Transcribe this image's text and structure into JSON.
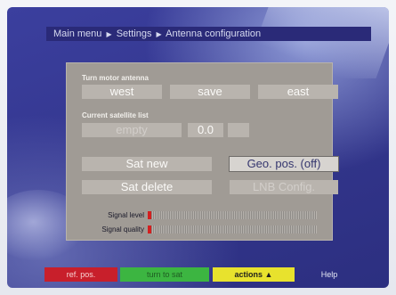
{
  "breadcrumb": {
    "item1": "Main menu",
    "item2": "Settings",
    "item3": "Antenna configuration",
    "separator_icon": "triangle-right-icon"
  },
  "motor": {
    "label": "Turn motor antenna",
    "west": "west",
    "save": "save",
    "east": "east"
  },
  "satellite_list": {
    "label": "Current satellite list",
    "value": "empty",
    "position": "0.0"
  },
  "actions": {
    "sat_new": "Sat new",
    "geo_pos": "Geo. pos. (off)",
    "sat_delete": "Sat delete",
    "lnb_config": "LNB Config."
  },
  "signal": {
    "level_label": "Signal level",
    "quality_label": "Signal quality",
    "level": 0.02,
    "quality": 0.02
  },
  "footer": {
    "red": "ref. pos.",
    "green": "turn to sat",
    "yellow": "actions",
    "yellow_icon": "triangle-up-icon",
    "help": "Help"
  },
  "colors": {
    "screen": "#34378f",
    "panel": "#a09b95",
    "red_key": "#c81f2b",
    "green_key": "#3cb541",
    "yellow_key": "#e8e22d",
    "signal_fill": "#d31f1f"
  }
}
